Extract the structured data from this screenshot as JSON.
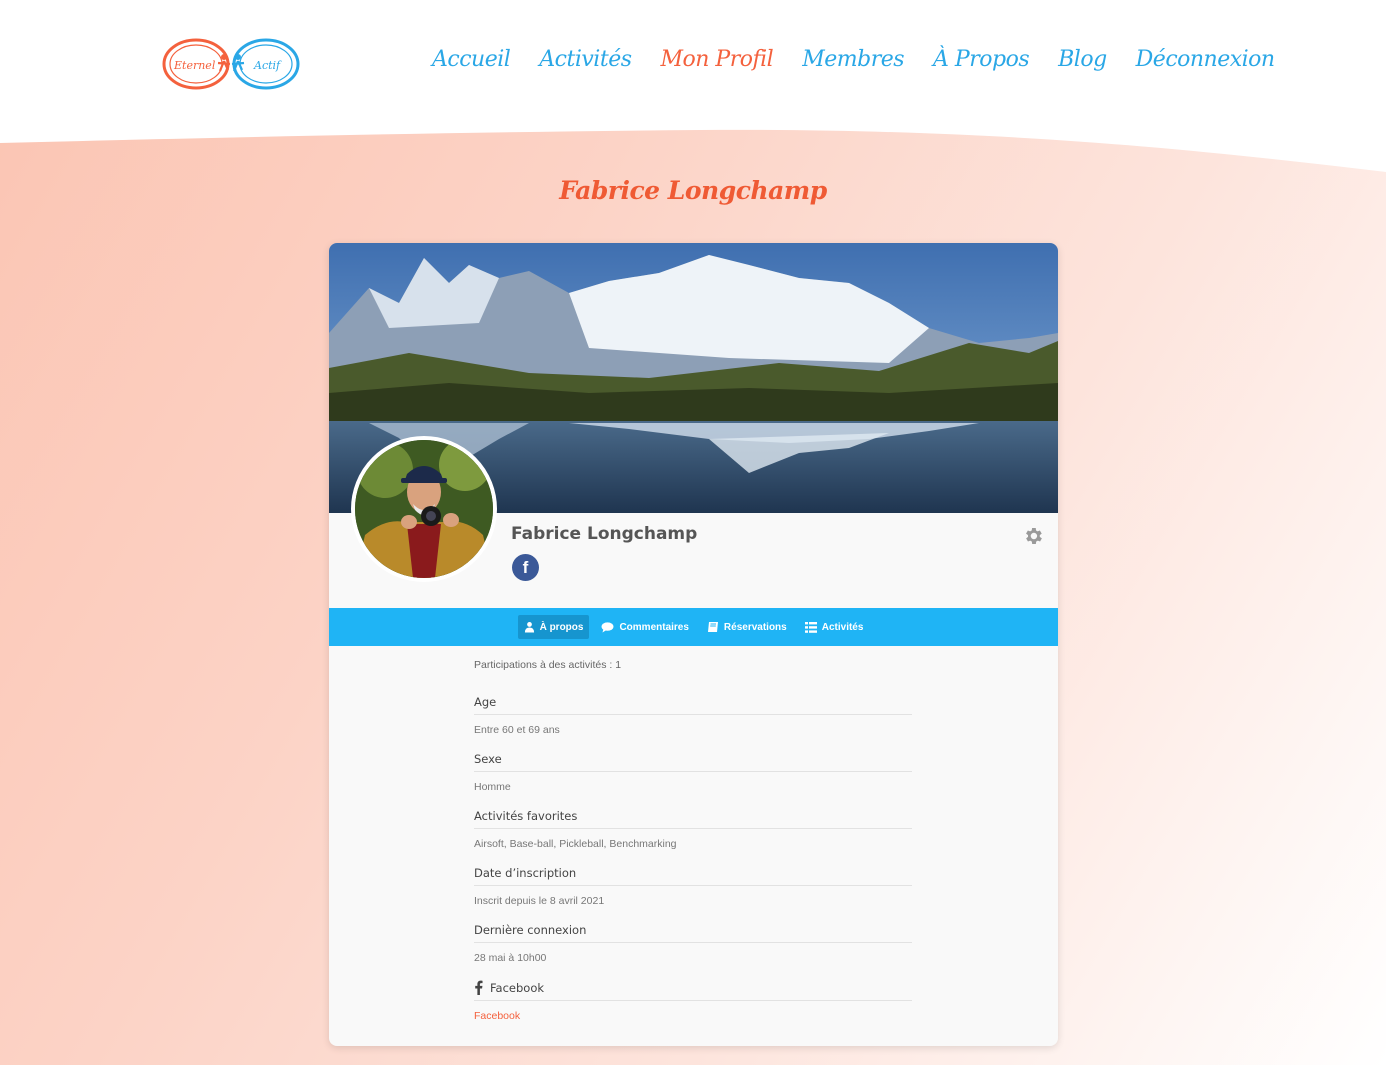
{
  "logo": {
    "text_left": "Eternel",
    "text_right": "Actif"
  },
  "nav": {
    "items": [
      {
        "label": "Accueil",
        "active": false
      },
      {
        "label": "Activités",
        "active": false
      },
      {
        "label": "Mon Profil",
        "active": true
      },
      {
        "label": "Membres",
        "active": false
      },
      {
        "label": "À Propos",
        "active": false
      },
      {
        "label": "Blog",
        "active": false
      },
      {
        "label": "Déconnexion",
        "active": false
      }
    ]
  },
  "page": {
    "title": "Fabrice Longchamp"
  },
  "profile": {
    "name": "Fabrice Longchamp",
    "facebook_glyph": "f"
  },
  "tabs": [
    {
      "label": "À propos",
      "icon": "user-icon",
      "active": true
    },
    {
      "label": "Commentaires",
      "icon": "comment-icon",
      "active": false
    },
    {
      "label": "Réservations",
      "icon": "book-icon",
      "active": false
    },
    {
      "label": "Activités",
      "icon": "list-icon",
      "active": false
    }
  ],
  "about": {
    "participations": "Participations à des activités : 1",
    "fields": [
      {
        "label": "Age",
        "value": "Entre 60 et 69 ans"
      },
      {
        "label": "Sexe",
        "value": "Homme"
      },
      {
        "label": "Activités favorites",
        "value": "Airsoft, Base-ball, Pickleball, Benchmarking"
      },
      {
        "label": "Date d’inscription",
        "value": "Inscrit depuis le 8 avril 2021"
      },
      {
        "label": "Dernière connexion",
        "value": "28 mai à 10h00"
      },
      {
        "label": "Facebook",
        "value": "Facebook"
      }
    ]
  },
  "colors": {
    "accent": "#f4613d",
    "nav_blue": "#2aa7e6",
    "tab_bar": "#1fb4f5",
    "facebook": "#3b5998"
  }
}
